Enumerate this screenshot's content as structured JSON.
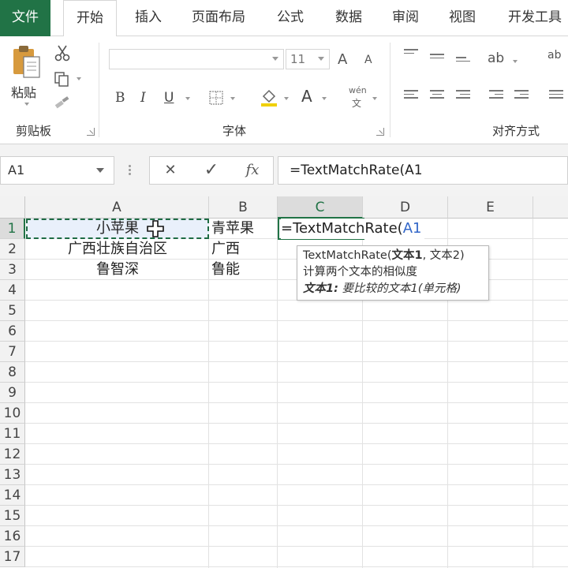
{
  "ribbon_tabs": [
    {
      "label": "文件"
    },
    {
      "label": "开始"
    },
    {
      "label": "插入"
    },
    {
      "label": "页面布局"
    },
    {
      "label": "公式"
    },
    {
      "label": "数据"
    },
    {
      "label": "审阅"
    },
    {
      "label": "视图"
    },
    {
      "label": "开发工具"
    }
  ],
  "active_tab": "开始",
  "clipboard": {
    "paste_label": "粘贴",
    "group_label": "剪贴板"
  },
  "font": {
    "font_name": "",
    "font_size": "11",
    "group_label": "字体",
    "bold": "B",
    "italic": "I",
    "underline": "U",
    "grow": "A",
    "shrink": "A",
    "font_color": "A",
    "phonetic": "wén"
  },
  "alignment": {
    "group_label": "对齐方式"
  },
  "formula_bar": {
    "name_box": "A1",
    "cancel": "✕",
    "enter": "✓",
    "fx": "fx",
    "formula": "=TextMatchRate(A1"
  },
  "columns": [
    "A",
    "B",
    "C",
    "D",
    "E"
  ],
  "rows": [
    "1",
    "2",
    "3",
    "4",
    "5",
    "6",
    "7",
    "8",
    "9",
    "10",
    "11",
    "12",
    "13",
    "14",
    "15",
    "16",
    "17"
  ],
  "cells": {
    "A1": "小苹果",
    "A2": "广西壮族自治区",
    "A3": "鲁智深",
    "B1": "青苹果",
    "B2": "广西",
    "B3": "鲁能"
  },
  "editing_cell": {
    "prefix": "=TextMatchRate(",
    "ref": "A1"
  },
  "tooltip": {
    "fn_name": "TextMatchRate(",
    "arg1": "文本1",
    "rest": ", 文本2)",
    "description": "计算两个文本的相似度",
    "arg_name": "文本1:",
    "arg_desc": " 要比较的文本1(单元格)"
  },
  "colors": {
    "accent": "#217346",
    "reference": "#3166c8"
  }
}
